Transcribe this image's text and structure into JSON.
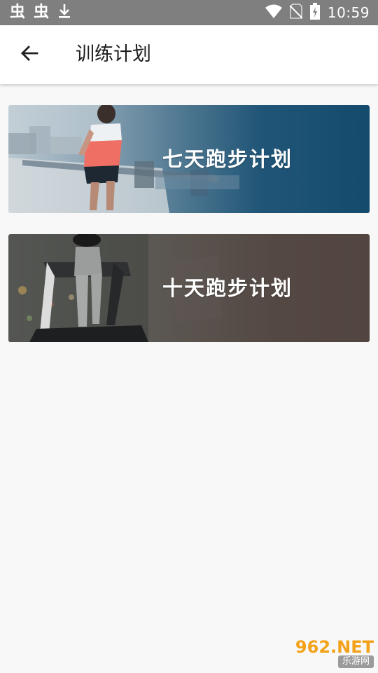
{
  "status_bar": {
    "notifications": [
      "虫",
      "虫"
    ],
    "time": "10:59"
  },
  "header": {
    "title": "训练计划"
  },
  "plans": [
    {
      "label": "七天跑步计划"
    },
    {
      "label": "十天跑步计划"
    }
  ],
  "watermark": {
    "top": "962.NET",
    "bottom": "乐游网"
  },
  "colors": {
    "status_bar": "#7f7f7f",
    "app_bar": "#ffffff",
    "background": "#f8f8f8",
    "card1_accent": "#144b6d",
    "card2_accent": "#524540"
  }
}
